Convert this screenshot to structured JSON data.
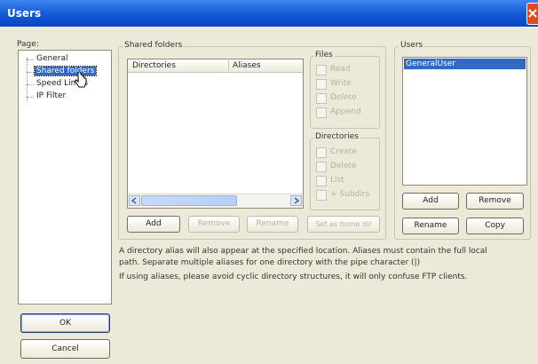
{
  "window": {
    "title": "Users"
  },
  "page_label": "Page:",
  "tree": [
    "General",
    "Shared folders",
    "Speed Limits",
    "IP Filter"
  ],
  "shared": {
    "label": "Shared folders",
    "columns": [
      "Directories",
      "Aliases"
    ],
    "buttons": {
      "add": "Add",
      "remove": "Remove",
      "rename": "Rename",
      "home": "Set as home dir"
    }
  },
  "files": {
    "label": "Files",
    "options": [
      "Read",
      "Write",
      "Delete",
      "Append"
    ]
  },
  "directories": {
    "label": "Directories",
    "options": [
      "Create",
      "Delete",
      "List",
      "+ Subdirs"
    ]
  },
  "users": {
    "label": "Users",
    "items": [
      "GeneralUser"
    ],
    "buttons": {
      "add": "Add",
      "remove": "Remove",
      "rename": "Rename",
      "copy": "Copy"
    }
  },
  "info": {
    "line1": "A directory alias will also appear at the specified location. Aliases must contain the full local",
    "line2": "path. Separate multiple aliases for one directory with the pipe character (|)",
    "line3": "If using aliases, please avoid cyclic directory structures, it will only confuse FTP clients."
  },
  "ok": "OK",
  "cancel": "Cancel",
  "colors": {
    "title_bar": "#1457d6",
    "selection": "#316ac5",
    "dialog_bg": "#ece9d8"
  }
}
